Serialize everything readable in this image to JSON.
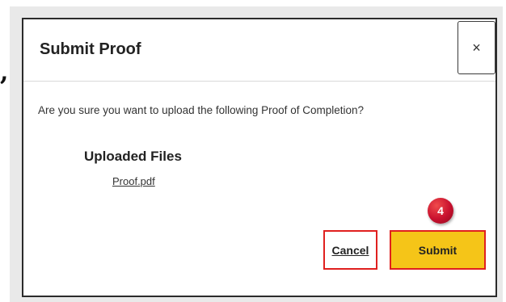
{
  "page": {
    "stray_mark": ","
  },
  "dialog": {
    "title": "Submit Proof",
    "close_label": "×",
    "message": "Are you sure you want to upload the following Proof of Completion?",
    "files_heading": "Uploaded Files",
    "files": [
      "Proof.pdf"
    ],
    "step_badge": "4",
    "cancel_label": "Cancel",
    "submit_label": "Submit"
  },
  "colors": {
    "highlight_outline": "#e0201f",
    "submit_fill": "#f5c518",
    "badge_fill": "#c8102e"
  },
  "icons": {
    "close": "close-icon"
  }
}
